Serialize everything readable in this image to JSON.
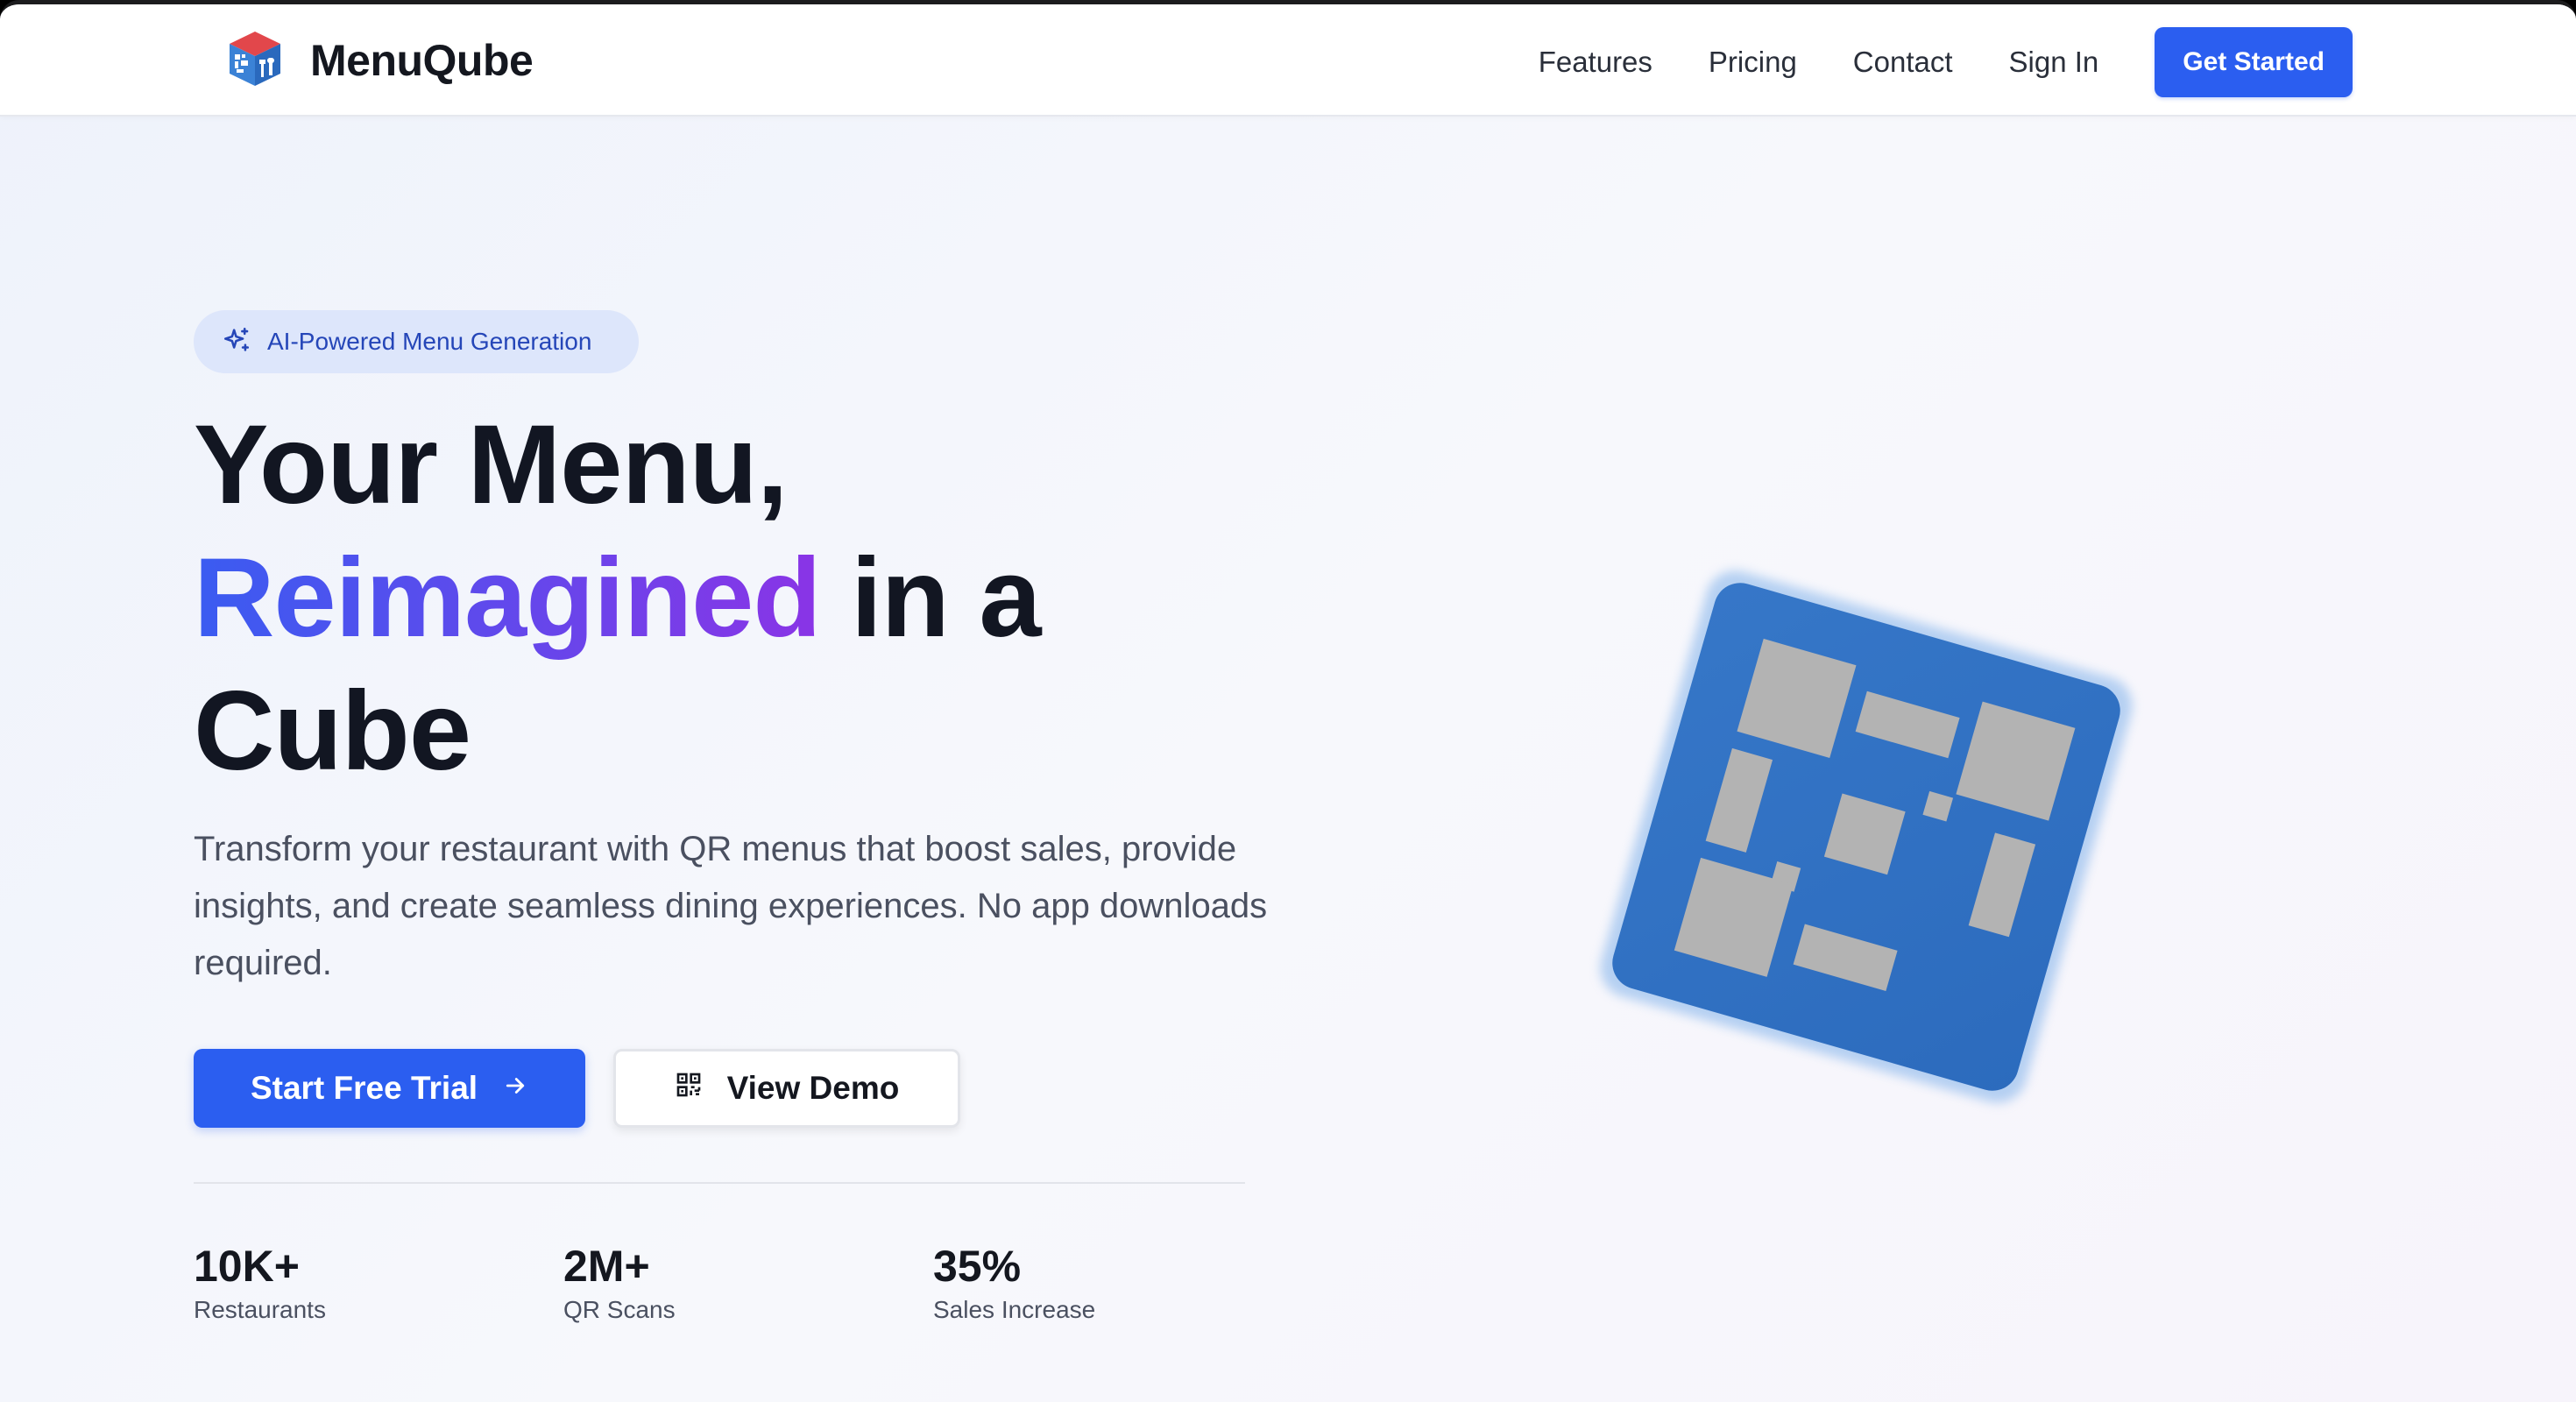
{
  "brand": {
    "name": "MenuQube"
  },
  "nav": {
    "links": [
      "Features",
      "Pricing",
      "Contact",
      "Sign In"
    ],
    "cta": "Get Started"
  },
  "hero": {
    "badge": "AI-Powered Menu Generation",
    "headline_line1": "Your Menu,",
    "headline_highlight": "Reimagined",
    "headline_rest": " in a",
    "headline_line3": "Cube",
    "subtext": "Transform your restaurant with QR menus that boost sales, provide insights, and create seamless dining experiences. No app downloads required.",
    "primary_cta": "Start Free Trial",
    "secondary_cta": "View Demo"
  },
  "stats": [
    {
      "value": "10K+",
      "label": "Restaurants"
    },
    {
      "value": "2M+",
      "label": "QR Scans"
    },
    {
      "value": "35%",
      "label": "Sales Increase"
    }
  ],
  "colors": {
    "accent": "#2b5ef0",
    "gradient_start": "#3a5cf1",
    "gradient_end": "#8a34e6",
    "cube_blue": "#2f6fc0",
    "cube_tiles": "#b3b3b3"
  },
  "icons": {
    "brand": "cube-logo-icon",
    "badge": "sparkles-icon",
    "primary_cta": "arrow-right-icon",
    "secondary_cta": "qr-code-icon"
  }
}
